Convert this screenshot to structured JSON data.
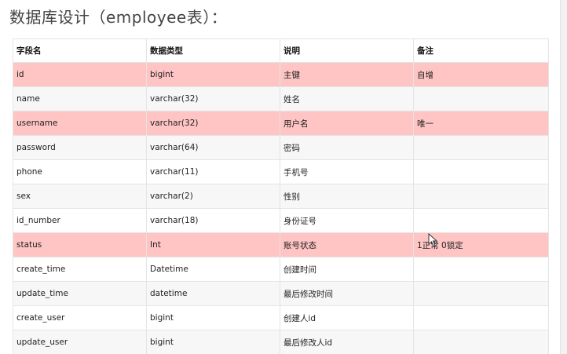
{
  "title": "数据库设计（employee表）：",
  "table": {
    "headers": [
      "字段名",
      "数据类型",
      "说明",
      "备注"
    ],
    "rows": [
      {
        "field": "id",
        "type": "bigint",
        "desc": "主键",
        "note": "自增",
        "highlight": true
      },
      {
        "field": "name",
        "type": "varchar(32)",
        "desc": "姓名",
        "note": "",
        "highlight": false
      },
      {
        "field": "username",
        "type": "varchar(32)",
        "desc": "用户名",
        "note": "唯一",
        "highlight": true
      },
      {
        "field": "password",
        "type": "varchar(64)",
        "desc": "密码",
        "note": "",
        "highlight": false
      },
      {
        "field": "phone",
        "type": "varchar(11)",
        "desc": "手机号",
        "note": "",
        "highlight": false
      },
      {
        "field": "sex",
        "type": "varchar(2)",
        "desc": "性别",
        "note": "",
        "highlight": false
      },
      {
        "field": "id_number",
        "type": "varchar(18)",
        "desc": "身份证号",
        "note": "",
        "highlight": false
      },
      {
        "field": "status",
        "type": "Int",
        "desc": "账号状态",
        "note": "1正常 0锁定",
        "highlight": true
      },
      {
        "field": "create_time",
        "type": "Datetime",
        "desc": "创建时间",
        "note": "",
        "highlight": false
      },
      {
        "field": "update_time",
        "type": "datetime",
        "desc": "最后修改时间",
        "note": "",
        "highlight": false
      },
      {
        "field": "create_user",
        "type": "bigint",
        "desc": "创建人id",
        "note": "",
        "highlight": false
      },
      {
        "field": "update_user",
        "type": "bigint",
        "desc": "最后修改人id",
        "note": "",
        "highlight": false
      }
    ]
  },
  "colors": {
    "highlight_row": "#ffc4c4",
    "stripe_row": "#f7f7f7",
    "border": "#e4e4e4"
  },
  "cursor_icon": "mouse-pointer-icon"
}
